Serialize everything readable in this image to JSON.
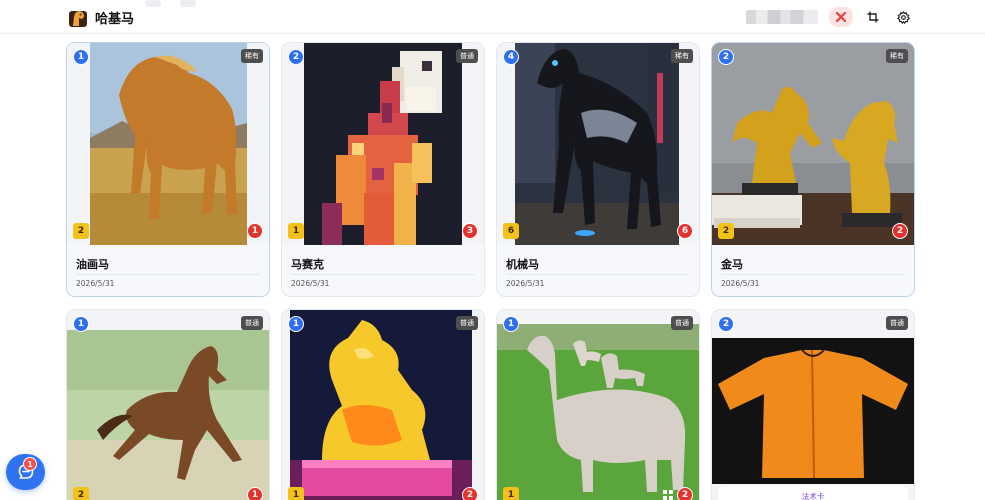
{
  "header": {
    "app_title": "哈基马",
    "icons": [
      "horse-logo-icon",
      "close-x-icon",
      "crop-icon",
      "gear-icon"
    ]
  },
  "colors": {
    "accent_blue": "#2f6ff1",
    "badge_yellow": "#f2c21b",
    "badge_red": "#e4322d",
    "tag_gray": "#4e4e4e",
    "cta_purple": "#7a3fe0"
  },
  "cards": [
    {
      "rank": "1",
      "tag": "稀有",
      "left_count": "2",
      "right_count": "1",
      "name": "油画马",
      "date": "2026/5/31"
    },
    {
      "rank": "2",
      "tag": "普通",
      "left_count": "1",
      "right_count": "3",
      "name": "马赛克",
      "date": "2026/5/31"
    },
    {
      "rank": "4",
      "tag": "稀有",
      "left_count": "6",
      "right_count": "6",
      "name": "机械马",
      "date": "2026/5/31"
    },
    {
      "rank": "2",
      "tag": "稀有",
      "left_count": "2",
      "right_count": "2",
      "name": "金马",
      "date": "2026/5/31"
    },
    {
      "rank": "1",
      "tag": "普通",
      "left_count": "2",
      "right_count": "1"
    },
    {
      "rank": "1",
      "tag": "普通",
      "left_count": "1",
      "right_count": "2"
    },
    {
      "rank": "1",
      "tag": "普通",
      "left_count": "1",
      "right_count": "2"
    },
    {
      "rank": "2",
      "tag": "普通",
      "cta_label": "法术卡"
    }
  ],
  "chat": {
    "badge": "1"
  }
}
